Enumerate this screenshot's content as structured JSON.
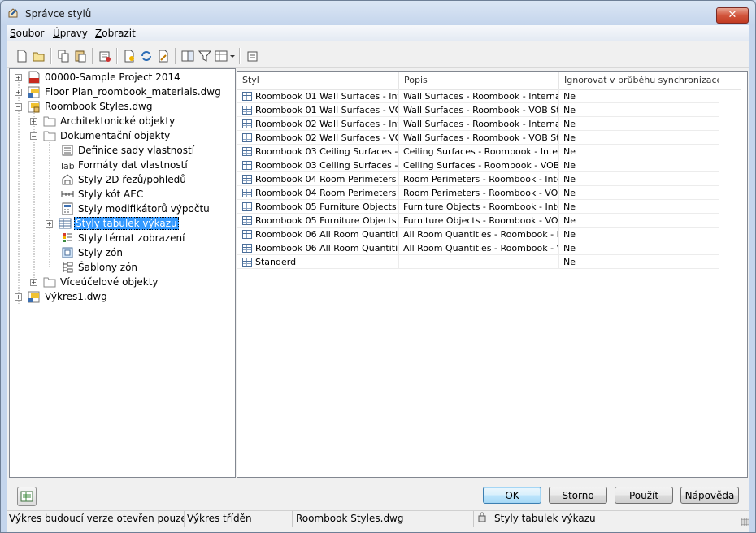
{
  "window": {
    "title": "Správce stylů"
  },
  "menu": [
    {
      "label": "Soubor",
      "underline": "S",
      "rest": "oubor"
    },
    {
      "label": "Úpravy",
      "underline": "Ú",
      "rest": "pravy"
    },
    {
      "label": "Zobrazit",
      "underline": "Z",
      "rest": "obrazit"
    }
  ],
  "toolbar": {
    "icons": [
      "new-icon",
      "open-icon",
      "copy-icon",
      "paste-icon",
      "purge-icon",
      "new-style-icon",
      "synchronize-icon",
      "edit-icon",
      "compare-icon",
      "filter-icon",
      "view-mode-icon",
      "properties-icon"
    ]
  },
  "tree": {
    "items": [
      {
        "label": "00000-Sample Project 2014",
        "icon": "project-icon"
      },
      {
        "label": "Floor Plan_roombook_materials.dwg",
        "icon": "dwg-icon"
      },
      {
        "label": "Roombook Styles.dwg",
        "icon": "dwg-lock-icon"
      },
      {
        "label": "Architektonické objekty",
        "icon": "folder-icon"
      },
      {
        "label": "Dokumentační objekty",
        "icon": "folder-icon"
      },
      {
        "label": "Definice sady vlastností",
        "icon": "property-set-icon"
      },
      {
        "label": "Formáty dat vlastností",
        "icon": "data-format-icon"
      },
      {
        "label": "Styly 2D řezů/pohledů",
        "icon": "section-icon"
      },
      {
        "label": "Styly kót AEC",
        "icon": "dimension-icon"
      },
      {
        "label": "Styly modifikátorů výpočtu",
        "icon": "calculation-icon"
      },
      {
        "label": "Styly tabulek výkazu",
        "icon": "schedule-table-icon"
      },
      {
        "label": "Styly témat zobrazení",
        "icon": "display-theme-icon"
      },
      {
        "label": "Styly zón",
        "icon": "zone-icon"
      },
      {
        "label": "Šablony zón",
        "icon": "zone-template-icon"
      },
      {
        "label": "Víceúčelové objekty",
        "icon": "folder-icon"
      },
      {
        "label": "Výkres1.dwg",
        "icon": "dwg-icon"
      }
    ]
  },
  "list": {
    "columns": [
      "Styl",
      "Popis",
      "Ignorovat v průběhu synchronizace..."
    ],
    "rows": [
      [
        "Roombook 01 Wall Surfaces - Int...",
        "Wall Surfaces - Roombook - Interna",
        "Ne"
      ],
      [
        "Roombook 01 Wall Surfaces - VO...",
        "Wall Surfaces - Roombook - VOB Stand",
        "Ne"
      ],
      [
        "Roombook 02 Wall Surfaces - Int...",
        "Wall Surfaces - Roombook - Interna",
        "Ne"
      ],
      [
        "Roombook 02 Wall Surfaces - VO...",
        "Wall Surfaces - Roombook - VOB Stand",
        "Ne"
      ],
      [
        "Roombook 03 Ceiling Surfaces - ...",
        "Ceiling Surfaces - Roombook - Interna",
        "Ne"
      ],
      [
        "Roombook 03 Ceiling Surfaces - ...",
        "Ceiling Surfaces - Roombook - VOB ...",
        "Ne"
      ],
      [
        "Roombook 04 Room Perimeters - ...",
        "Room Perimeters - Roombook - Inte...",
        "Ne"
      ],
      [
        "Roombook 04 Room Perimeters - ...",
        "Room Perimeters - Roombook - VOB ...",
        "Ne"
      ],
      [
        "Roombook 05 Furniture Objects -...",
        "Furniture Objects - Roombook - Inte...",
        "Ne"
      ],
      [
        "Roombook 05 Furniture Objects -...",
        "Furniture Objects - Roombook - VOB...",
        "Ne"
      ],
      [
        "Roombook 06 All Room Quantitie...",
        "All Room Quantities - Roombook - In...",
        "Ne"
      ],
      [
        "Roombook 06 All Room Quantitie...",
        "All Room Quantities - Roombook - V...",
        "Ne"
      ],
      [
        "Standerd",
        "",
        "Ne"
      ]
    ]
  },
  "buttons": {
    "ok": "OK",
    "cancel": "Storno",
    "apply": "Použít",
    "help": "Nápověda"
  },
  "status": {
    "version_msg": "Výkres budoucí verze otevřen pouze ke č",
    "sorted": "Výkres tříděn",
    "drawing": "Roombook Styles.dwg",
    "style_type": "Styly tabulek výkazu"
  },
  "colors": {
    "selection": "#3399ff",
    "close_button": "#c9402a"
  }
}
